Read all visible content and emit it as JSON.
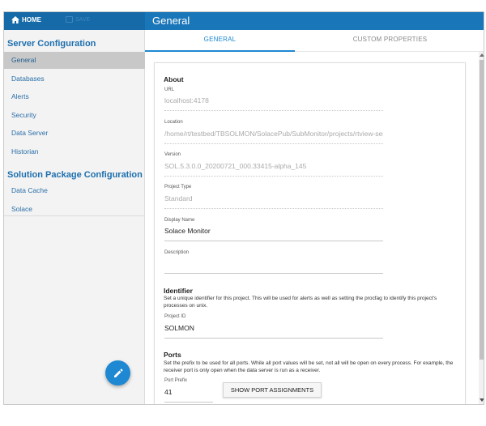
{
  "topbar": {
    "home_label": "HOME",
    "save_label": "SAVE",
    "title": "General"
  },
  "sidebar": {
    "server_header": "Server Configuration",
    "server_items": [
      {
        "label": "General"
      },
      {
        "label": "Databases"
      },
      {
        "label": "Alerts"
      },
      {
        "label": "Security"
      },
      {
        "label": "Data Server"
      },
      {
        "label": "Historian"
      }
    ],
    "solution_header": "Solution Package Configuration",
    "solution_items": [
      {
        "label": "Data Cache"
      },
      {
        "label": "Solace"
      }
    ]
  },
  "tabs": [
    {
      "label": "GENERAL"
    },
    {
      "label": "CUSTOM PROPERTIES"
    }
  ],
  "about": {
    "title": "About",
    "url_label": "URL",
    "url_value": "localhost:4178",
    "location_label": "Location",
    "location_value": "/home/rt/testbed/TBSOLMON/SolacePub/SubMonitor/projects/rtview-server",
    "version_label": "Version",
    "version_value": "SOL.5.3.0.0_20200721_000.33415-alpha_145",
    "project_type_label": "Project Type",
    "project_type_value": "Standard",
    "display_name_label": "Display Name",
    "display_name_value": "Solace Monitor",
    "description_label": "Description",
    "description_value": ""
  },
  "identifier": {
    "title": "Identifier",
    "description": "Set a unique identifier for this project. This will be used for alerts as well as setting the procfag to identify this project's processes on unix.",
    "project_id_label": "Project ID",
    "project_id_value": "SOLMON"
  },
  "ports": {
    "title": "Ports",
    "description": "Set the prefix to be used for all ports. While all port values will be set, not all will be open on every process. For example, the receiver port is only open when the data server is run as a receiver.",
    "port_prefix_label": "Port Prefix",
    "port_prefix_value": "41",
    "show_button_label": "SHOW PORT ASSIGNMENTS"
  },
  "colors": {
    "accent": "#1e88d2",
    "topbar": "#1976b8",
    "sidebar_heading": "#1d6fae"
  }
}
